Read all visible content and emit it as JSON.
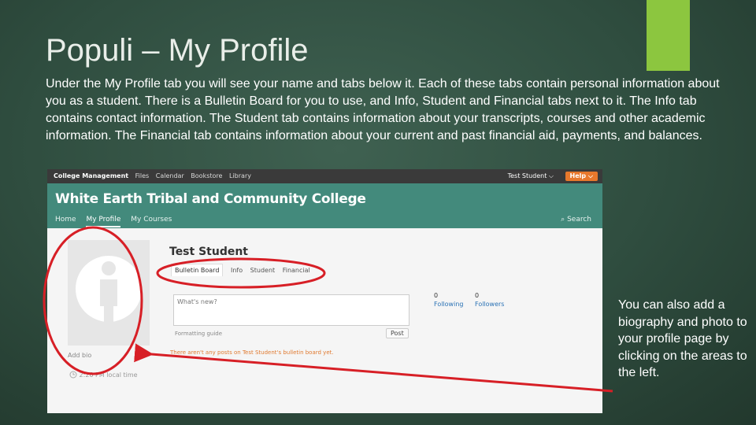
{
  "slide": {
    "title": "Populi – My Profile",
    "body": "Under the My Profile tab you will see your name and tabs below it. Each of these tabs contain personal information about you as a student. There is a Bulletin Board for you to use, and Info, Student and Financial tabs next to it. The Info tab contains contact information. The Student tab contains information about your transcripts, courses and other academic information. The Financial tab contains information about your current and past financial aid, payments, and balances.",
    "side_note": "You can also add a biography and photo to your profile page by clicking on the areas to the left."
  },
  "app": {
    "top_nav": [
      "College Management",
      "Files",
      "Calendar",
      "Bookstore",
      "Library"
    ],
    "user": "Test Student ⌵",
    "help": "Help ⌵",
    "college_name": "White Earth Tribal and Community College",
    "sub_nav": [
      "Home",
      "My Profile",
      "My Courses"
    ],
    "search": "⌕ Search",
    "profile": {
      "name": "Test Student",
      "tabs": [
        "Bulletin Board",
        "Info",
        "Student",
        "Financial"
      ],
      "composer_placeholder": "What's new?",
      "formatting_guide": "Formatting guide",
      "post_label": "Post",
      "no_posts": "There aren't any posts on Test Student's bulletin board yet.",
      "add_bio": "Add bio",
      "local_time": "2:26 PM local time",
      "following": {
        "count": "0",
        "label": "Following"
      },
      "followers": {
        "count": "0",
        "label": "Followers"
      }
    }
  },
  "colors": {
    "accent_bar": "#8cc63f",
    "banner": "#438a7c",
    "annotation": "#d71f26",
    "help_button": "#e8782c"
  },
  "icons": [
    "person-silhouette-icon",
    "clock-icon",
    "search-icon",
    "chevron-down-icon"
  ]
}
